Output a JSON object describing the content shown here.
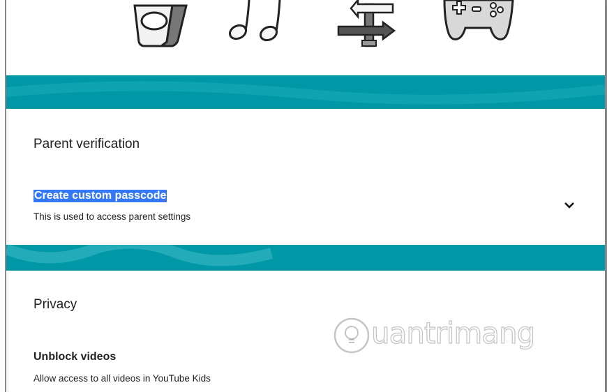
{
  "header": {
    "icons": [
      "tablet-icon",
      "music-notes-icon",
      "swap-arrows-icon",
      "gamepad-icon"
    ]
  },
  "colors": {
    "teal": "#0097a7",
    "selection": "#3478f6",
    "text": "#212121"
  },
  "parent_verification": {
    "title": "Parent verification",
    "passcode": {
      "label": "Create custom passcode",
      "description": "This is used to access parent settings"
    }
  },
  "privacy": {
    "title": "Privacy",
    "unblock": {
      "label": "Unblock videos",
      "description": "Allow access to all videos in YouTube Kids"
    }
  },
  "watermark": {
    "text": "uantrimang"
  }
}
